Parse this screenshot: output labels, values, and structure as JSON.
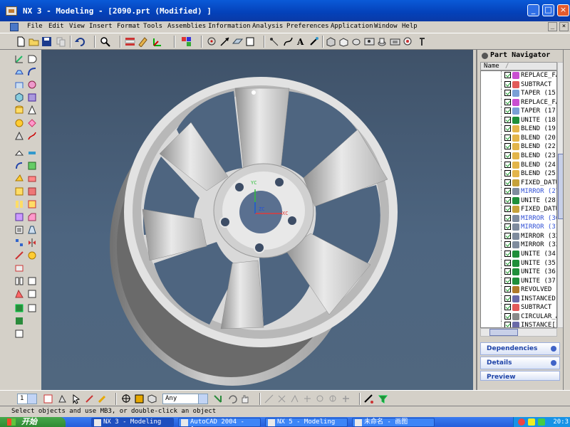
{
  "window": {
    "title": "NX 3 - Modeling - [2090.prt (Modified) ]",
    "minimize": "_",
    "maximize": "□",
    "close": "×"
  },
  "menu": {
    "items": [
      "File",
      "Edit",
      "View",
      "Insert",
      "Format",
      "Tools",
      "Assemblies",
      "Information",
      "Analysis",
      "Preferences",
      "Application",
      "Window",
      "Help"
    ],
    "mdi_minimize": "_",
    "mdi_close": "×"
  },
  "viewport": {
    "axis_labels": {
      "y": "YC",
      "z": "ZC",
      "x": "XC"
    }
  },
  "navigator": {
    "title": "Part Navigator",
    "column_name": "Name",
    "column_sep": "/",
    "rows": [
      {
        "label": "REPLACE_FA",
        "icon": "replace-face-icon",
        "selected": false
      },
      {
        "label": "SUBTRACT (",
        "icon": "subtract-icon",
        "selected": false
      },
      {
        "label": "TAPER (15)",
        "icon": "taper-icon",
        "selected": false
      },
      {
        "label": "REPLACE_FA",
        "icon": "replace-face-icon",
        "selected": false
      },
      {
        "label": "TAPER (17)",
        "icon": "taper-icon",
        "selected": false
      },
      {
        "label": "UNITE (18)",
        "icon": "unite-icon",
        "selected": false
      },
      {
        "label": "BLEND (19)",
        "icon": "blend-icon",
        "selected": false
      },
      {
        "label": "BLEND (20)",
        "icon": "blend-icon",
        "selected": false
      },
      {
        "label": "BLEND (22)",
        "icon": "blend-icon",
        "selected": false
      },
      {
        "label": "BLEND (23)",
        "icon": "blend-icon",
        "selected": false
      },
      {
        "label": "BLEND (24)",
        "icon": "blend-icon",
        "selected": false
      },
      {
        "label": "BLEND (25)",
        "icon": "blend-icon",
        "selected": false
      },
      {
        "label": "FIXED_DATU",
        "icon": "datum-icon",
        "selected": false
      },
      {
        "label": "MIRROR (27",
        "icon": "mirror-icon",
        "selected": true
      },
      {
        "label": "UNITE (28)",
        "icon": "unite-icon",
        "selected": false
      },
      {
        "label": "FIXED_DATU",
        "icon": "datum-icon",
        "selected": false
      },
      {
        "label": "MIRROR (30",
        "icon": "mirror-icon",
        "selected": true
      },
      {
        "label": "MIRROR (31",
        "icon": "mirror-icon",
        "selected": true
      },
      {
        "label": "MIRROR (32",
        "icon": "mirror-icon",
        "selected": false
      },
      {
        "label": "MIRROR (33",
        "icon": "mirror-icon",
        "selected": false
      },
      {
        "label": "UNITE (34)",
        "icon": "unite-icon",
        "selected": false
      },
      {
        "label": "UNITE (35)",
        "icon": "unite-icon",
        "selected": false
      },
      {
        "label": "UNITE (36)",
        "icon": "unite-icon",
        "selected": false
      },
      {
        "label": "UNITE (37)",
        "icon": "unite-icon",
        "selected": false
      },
      {
        "label": "REVOLVED (",
        "icon": "revolve-icon",
        "selected": false
      },
      {
        "label": "INSTANCED",
        "icon": "instance-icon",
        "selected": false
      },
      {
        "label": "SUBTRACT (",
        "icon": "subtract-icon",
        "selected": false
      },
      {
        "label": "CIRCULAR_A",
        "icon": "circular-array-icon",
        "selected": false
      },
      {
        "label": "INSTANCE[1",
        "icon": "instance-icon",
        "selected": false
      }
    ],
    "sections": [
      "Dependencies",
      "Details",
      "Preview"
    ]
  },
  "bottom_toolbar": {
    "layer_value": "1",
    "filter_value": "Any"
  },
  "status": {
    "message": "Select objects and use MB3, or double-click an object"
  },
  "taskbar": {
    "start": "开始",
    "tasks": [
      "NX 3 - Modeling",
      "AutoCAD 2004 - [...",
      "NX 5 - Modeling ...",
      "未命名 - 画图"
    ],
    "clock": "20:3"
  },
  "colors": {
    "title_blue": "#0a5ad8",
    "viewport_bg": "#4a5f78",
    "selected_text": "#2f4fd6",
    "panel_gray": "#d4d0c8"
  }
}
